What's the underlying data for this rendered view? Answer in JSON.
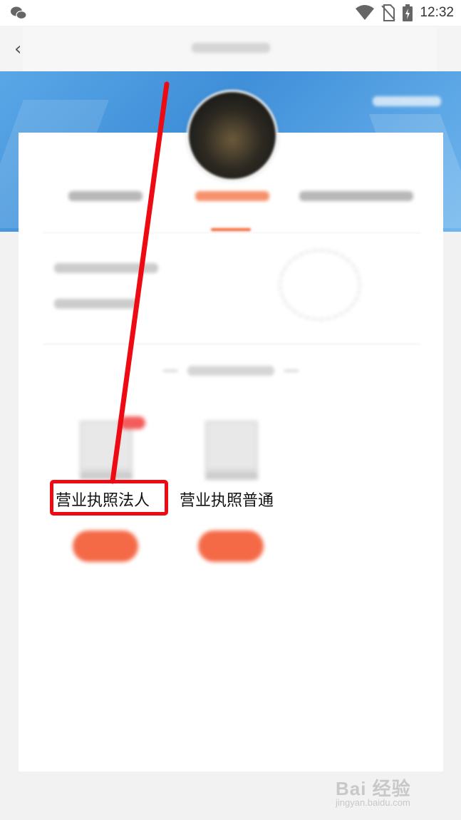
{
  "status_bar": {
    "time": "12:32"
  },
  "page": {
    "items": [
      {
        "label": "营业执照法人"
      },
      {
        "label": "营业执照普通"
      }
    ]
  },
  "watermark": {
    "brand": "Bai 经验",
    "url": "jingyan.baidu.com"
  },
  "colors": {
    "accent": "#f2622f",
    "banner": "#3f8fd9",
    "highlight": "#ee0a12"
  }
}
